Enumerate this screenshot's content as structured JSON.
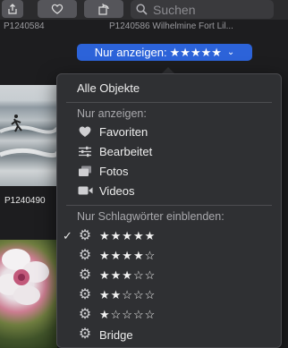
{
  "toolbar": {
    "search_placeholder": "Suchen"
  },
  "grid": {
    "top_captions": [
      "P1240584",
      "P1240586 Wilhelmine Fort Lil..."
    ],
    "photo_caption": "P1240490"
  },
  "filter": {
    "label": "Nur anzeigen:",
    "stars": "★★★★★",
    "chevron": "⌄"
  },
  "menu": {
    "all_objects": "Alle Objekte",
    "show_only_header": "Nur anzeigen:",
    "show_only_items": [
      {
        "label": "Favoriten",
        "icon": "heart-icon"
      },
      {
        "label": "Bearbeitet",
        "icon": "sliders-icon"
      },
      {
        "label": "Fotos",
        "icon": "photos-icon"
      },
      {
        "label": "Videos",
        "icon": "video-icon"
      }
    ],
    "keywords_header": "Nur Schlagwörter einblenden:",
    "keyword_items": [
      {
        "label": "★★★★★",
        "checked": true
      },
      {
        "label": "★★★★☆",
        "checked": false
      },
      {
        "label": "★★★☆☆",
        "checked": false
      },
      {
        "label": "★★☆☆☆",
        "checked": false
      },
      {
        "label": "★☆☆☆☆",
        "checked": false
      },
      {
        "label": "Bridge",
        "checked": false
      }
    ],
    "checkmark": "✓",
    "gear_glyph": "⚙"
  },
  "colors": {
    "accent": "#2c63d9",
    "menu_bg": "#2f3033"
  }
}
